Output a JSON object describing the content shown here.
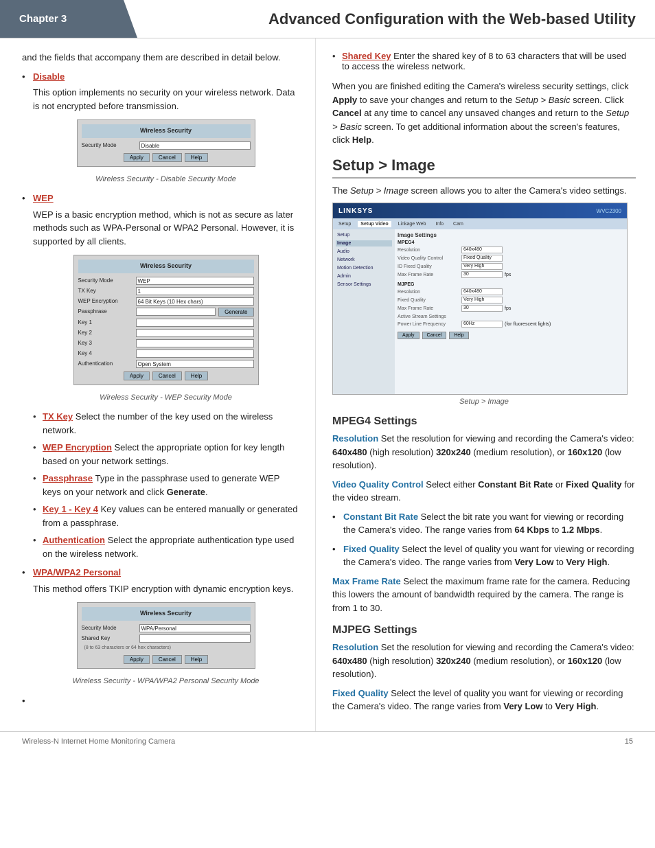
{
  "header": {
    "chapter_label": "Chapter 3",
    "title": "Advanced Configuration with the Web-based Utility"
  },
  "footer": {
    "left": "Wireless-N Internet Home Monitoring Camera",
    "right": "15"
  },
  "left_column": {
    "intro": "and the fields that accompany them are described in detail below.",
    "sections": [
      {
        "id": "disable",
        "label": "Disable",
        "body": "This option implements no security on your wireless network. Data is not encrypted before transmission.",
        "screenshot_caption": "Wireless Security - Disable Security Mode",
        "screenshot_id": "disable"
      },
      {
        "id": "wep",
        "label": "WEP",
        "body": "WEP is a basic encryption method, which is not as secure as later methods such as WPA-Personal or WPA2 Personal. However, it is supported by all clients.",
        "screenshot_caption": "Wireless Security - WEP Security Mode",
        "screenshot_id": "wep",
        "bullets": [
          {
            "label": "TX Key",
            "text": "Select the number of the key used on the wireless network."
          },
          {
            "label": "WEP Encryption",
            "text": "Select the appropriate option for key length based on your network settings."
          },
          {
            "label": "Passphrase",
            "text": "Type in the passphrase used to generate WEP keys on your network and click Generate."
          },
          {
            "label": "Key 1 - Key 4",
            "text": "Key values can be entered manually or generated from a passphrase."
          },
          {
            "label": "Authentication",
            "text": "Select the appropriate authentication type used on the wireless network."
          }
        ]
      },
      {
        "id": "wpa_wpa2",
        "label": "WPA/WPA2 Personal",
        "body": "This method offers TKIP encryption with dynamic encryption keys.",
        "screenshot_caption": "Wireless Security - WPA/WPA2 Personal Security Mode",
        "screenshot_id": "wpa"
      },
      {
        "id": "empty_bullet",
        "label": ""
      }
    ]
  },
  "right_column": {
    "shared_key_label": "Shared Key",
    "shared_key_text": "Enter the shared key of 8 to 63 characters that will be used to access the wireless network.",
    "finished_text": "When you are finished editing the Camera's wireless security settings, click Apply to save your changes and return to the Setup > Basic screen. Click Cancel at any time to cancel any unsaved changes and return to the Setup > Basic screen. To get additional information about the screen's features, click Help.",
    "apply_label": "Apply",
    "cancel_label": "Cancel",
    "help_label": "Help",
    "setup_image_heading": "Setup > Image",
    "setup_image_intro": "The Setup > Image screen allows you to alter the Camera's video settings.",
    "setup_image_caption": "Setup > Image",
    "mpeg4_heading": "MPEG4 Settings",
    "resolution_label": "Resolution",
    "resolution_text": "Set the resolution for viewing and recording the Camera's video: 640x480 (high resolution) 320x240 (medium resolution), or 160x120 (low resolution).",
    "resolution_640": "640x480",
    "resolution_320": "320x240",
    "resolution_160": "160x120",
    "vqc_label": "Video Quality Control",
    "vqc_text": "Select either Constant Bit Rate or Fixed Quality for the video stream.",
    "cbr_label": "Constant Bit Rate",
    "cbr_text": "Select the bit rate you want for viewing or recording the Camera's video. The range varies from 64 Kbps to 1.2 Mbps.",
    "cbr_range_low": "64 Kbps",
    "cbr_range_high": "1.2 Mbps",
    "fq_label": "Fixed Quality",
    "fq_text": "Select the level of quality you want for viewing or recording the Camera's video. The range varies from Very Low to Very High.",
    "fq_range_low": "Very Low",
    "fq_range_high": "Very High",
    "mfr_label": "Max Frame Rate",
    "mfr_text": "Select the maximum frame rate for the camera. Reducing this lowers the amount of bandwidth required by the camera. The range is from 1 to 30.",
    "mjpeg_heading": "MJPEG Settings",
    "mjpeg_resolution_label": "Resolution",
    "mjpeg_resolution_text": "Set the resolution for viewing and recording the Camera's video: 640x480 (high resolution) 320x240 (medium resolution), or 160x120 (low resolution).",
    "mjpeg_resolution_640": "640x480",
    "mjpeg_resolution_320": "320x240",
    "mjpeg_resolution_160": "160x120",
    "mjpeg_fq_label": "Fixed Quality",
    "mjpeg_fq_text": "Select the level of quality you want for viewing or recording the Camera's video. The range varies from Very Low to Very High.",
    "mjpeg_fq_low": "Very Low",
    "mjpeg_fq_high": "Very High"
  }
}
